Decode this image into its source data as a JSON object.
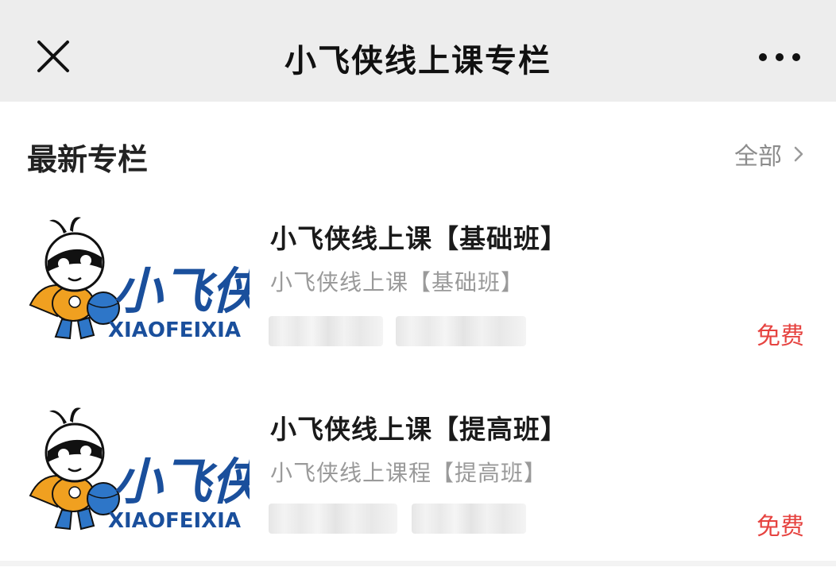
{
  "nav": {
    "title": "小飞侠线上课专栏",
    "close_icon": "close-icon",
    "more_icon": "more-dots-icon"
  },
  "section": {
    "title": "最新专栏",
    "see_all_label": "全部",
    "see_all_icon": "chevron-right-icon"
  },
  "courses": [
    {
      "title": "小飞侠线上课【基础班】",
      "subtitle": "小飞侠线上课【基础班】",
      "price": "免费",
      "logo_text": "小飞侠",
      "logo_subtext": "XIAOFEIXIA"
    },
    {
      "title": "小飞侠线上课【提高班】",
      "subtitle": "小飞侠线上课程【提高班】",
      "price": "免费",
      "logo_text": "小飞侠",
      "logo_subtext": "XIAOFEIXIA"
    }
  ],
  "colors": {
    "nav_bg": "#ededed",
    "price": "#e64340",
    "logo_blue": "#1a4f9c",
    "mascot_orange": "#f0a020"
  }
}
